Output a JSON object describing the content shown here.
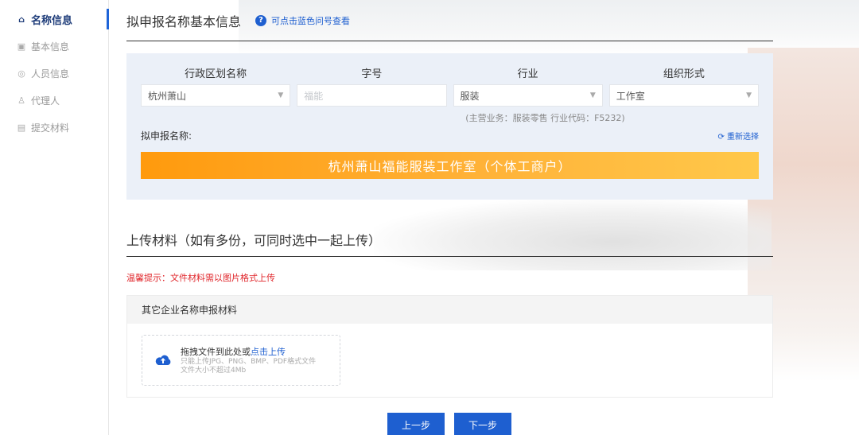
{
  "sidebar": {
    "items": [
      {
        "label": "名称信息",
        "icon": "home-icon",
        "active": true
      },
      {
        "label": "基本信息",
        "icon": "info-card-icon",
        "active": false
      },
      {
        "label": "人员信息",
        "icon": "person-circle-icon",
        "active": false
      },
      {
        "label": "代理人",
        "icon": "agent-icon",
        "active": false
      },
      {
        "label": "提交材料",
        "icon": "document-icon",
        "active": false
      }
    ]
  },
  "name_section": {
    "title": "拟申报名称基本信息",
    "help_text": "可点击蓝色问号查看",
    "columns": [
      "行政区划名称",
      "字号",
      "行业",
      "组织形式"
    ],
    "fields": {
      "region": "杭州萧山",
      "trade_name_placeholder": "福能",
      "industry": "服装",
      "org_form": "工作室"
    },
    "hint": "(主营业务：服装零售  行业代码：F5232)",
    "proposed_label": "拟申报名称:",
    "reselect": "重新选择",
    "proposed_name": "杭州萧山福能服装工作室（个体工商户）"
  },
  "upload_section": {
    "title": "上传材料（如有多份，可同时选中一起上传）",
    "warning": "温馨提示：文件材料需以图片格式上传",
    "panel_title": "其它企业名称申报材料",
    "drop_text": "拖拽文件到此处或",
    "drop_link": "点击上传",
    "drop_hint1": "只能上传JPG、PNG、BMP、PDF格式文件",
    "drop_hint2": "文件大小不超过4Mb"
  },
  "buttons": {
    "prev": "上一步",
    "next": "下一步"
  },
  "colors": {
    "accent": "#1e5fd0",
    "warning": "#e0262b",
    "name_bar_start": "#ff9a0d",
    "name_bar_end": "#ffc84a",
    "name_box_bg": "#ebf0f8"
  }
}
